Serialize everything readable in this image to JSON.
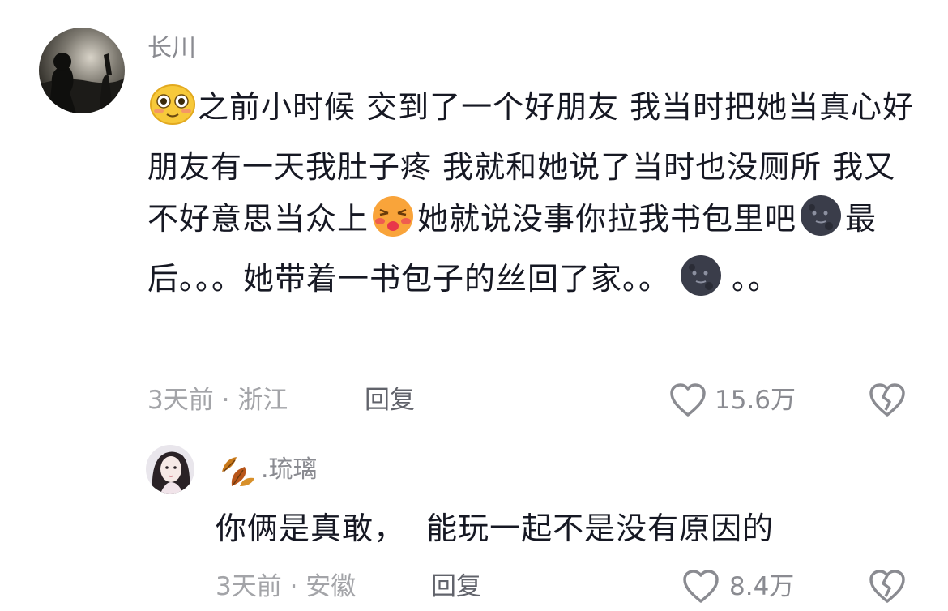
{
  "comments": [
    {
      "author": "长川",
      "text_parts": [
        "之前小时候 交到了一个好朋友 我当时把她当真心好朋友有一天我肚子疼 我就和她说了当时也没厕所 我又不好意思当众上",
        "她就说没事你拉我书包里吧",
        "最后。。。她带着一书包子的丝回了家。。",
        "。。"
      ],
      "emojis": [
        "blush-face-emoji",
        "kissing-face-emoji",
        "new-moon-face-emoji",
        "new-moon-face-emoji"
      ],
      "time_location": "3天前 · 浙江",
      "reply_label": "回复",
      "like_count": "15.6万",
      "icons": [
        "heart-icon",
        "dislike-broken-heart-icon"
      ]
    },
    {
      "author": ".琉璃",
      "author_badge_icon": "autumn-leaves-icon",
      "text": "你俩是真敢，  能玩一起不是没有原因的",
      "time_location": "3天前 · 安徽",
      "reply_label": "回复",
      "like_count": "8.4万",
      "icons": [
        "heart-icon",
        "dislike-broken-heart-icon"
      ]
    }
  ],
  "colors": {
    "text": "#161823",
    "secondary": "#8a8b91",
    "meta": "#a3a4a8",
    "background": "#ffffff"
  }
}
